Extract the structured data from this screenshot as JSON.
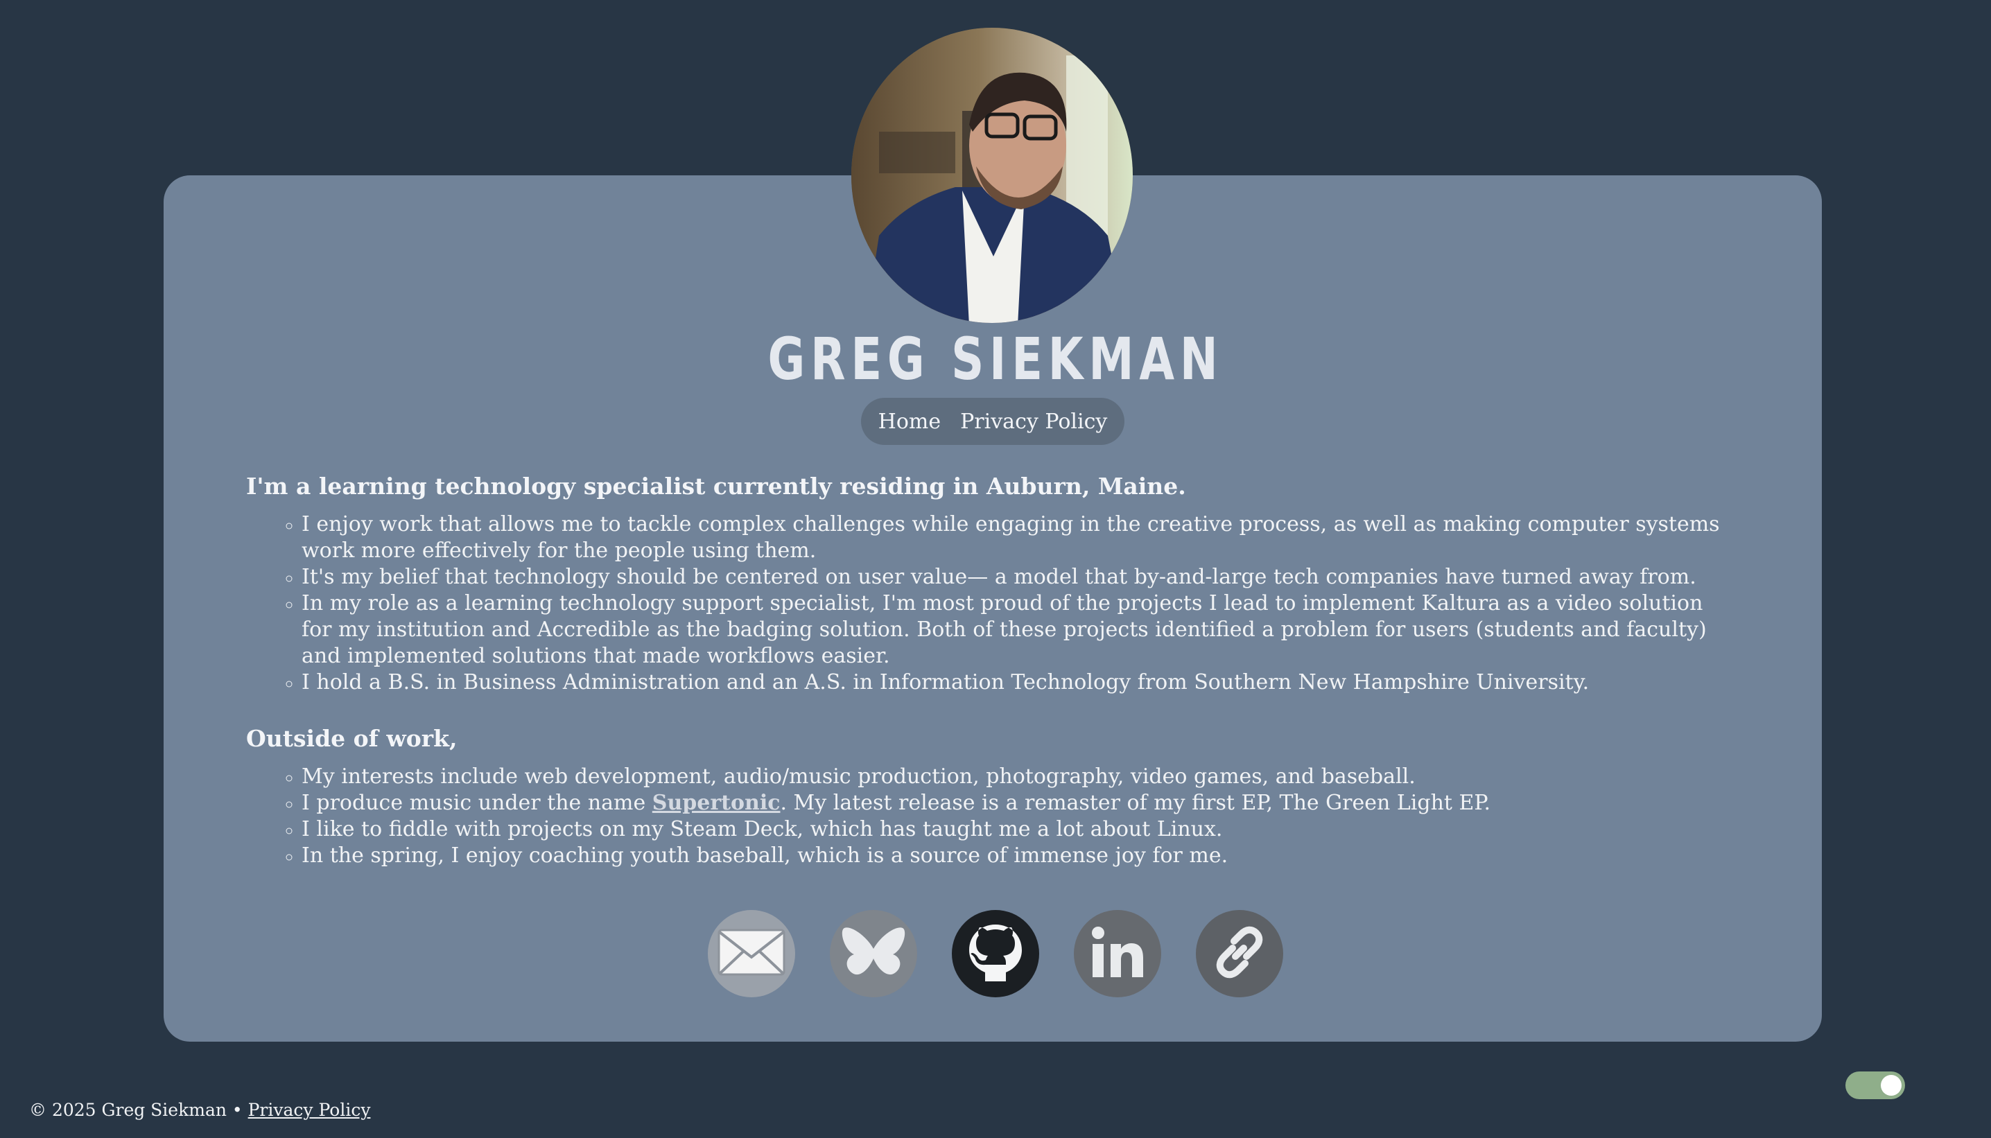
{
  "profile": {
    "name": "GREG SIEKMAN",
    "avatar_icon": "profile-photo"
  },
  "nav": {
    "home": "Home",
    "privacy": "Privacy Policy"
  },
  "about": {
    "heading": "I'm a learning technology specialist currently residing in Auburn, Maine.",
    "items": [
      "I enjoy work that allows me to tackle complex challenges while engaging in the creative process, as well as making computer systems work more effectively for the people using them.",
      "It's my belief that technology should be centered on user value— a model that by-and-large tech companies have turned away from.",
      "In my role as a learning technology support specialist, I'm most proud of the projects I lead to implement Kaltura as a video solution for my institution and Accredible as the badging solution. Both of these projects identified a problem for users (students and faculty) and implemented solutions that made workflows easier.",
      "I hold a B.S. in Business Administration and an A.S. in Information Technology from Southern New Hampshire University."
    ]
  },
  "outside": {
    "heading": "Outside of work,",
    "item1": "My interests include web development, audio/music production, photography, video games, and baseball.",
    "item2_before": "I produce music under the name ",
    "item2_link": "Supertonic",
    "item2_after": ". My latest release is a remaster of my first EP, The Green Light EP.",
    "item3": "I like to fiddle with projects on my Steam Deck, which has taught me a lot about Linux.",
    "item4": "In the spring, I enjoy coaching youth baseball, which is a source of immense joy for me."
  },
  "socials": [
    {
      "icon": "email-icon",
      "color": "#9aa1aa"
    },
    {
      "icon": "bluesky-icon",
      "color": "#7f858c"
    },
    {
      "icon": "github-icon",
      "color": "#1b1f23"
    },
    {
      "icon": "linkedin-icon",
      "color": "#666a6f"
    },
    {
      "icon": "link-icon",
      "color": "#5d6166"
    }
  ],
  "footer": {
    "copyright": "© 2025 Greg Siekman • ",
    "privacy": "Privacy Policy"
  },
  "theme_toggle": {
    "state": "on",
    "color": "#8fae8a"
  }
}
